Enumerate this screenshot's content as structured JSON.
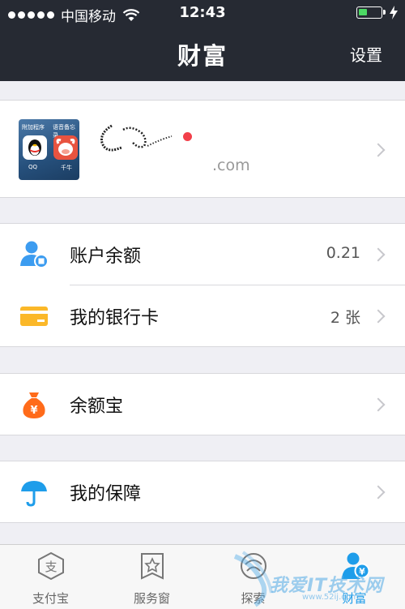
{
  "status": {
    "carrier": "中国移动",
    "time": "12:43",
    "battery_level": 0.4
  },
  "nav": {
    "title": "财富",
    "settings_label": "设置"
  },
  "profile": {
    "email_suffix": ".com",
    "avatar_labels": [
      "附加程序",
      "语音备忘录",
      "QQ",
      "千牛"
    ]
  },
  "rows": {
    "balance": {
      "label": "账户余额",
      "value": "0.21",
      "icon": "user-balance-icon"
    },
    "bank_card": {
      "label": "我的银行卡",
      "value": "2 张",
      "icon": "card-icon"
    },
    "yuebao": {
      "label": "余额宝",
      "icon": "money-bag-icon"
    },
    "insurance": {
      "label": "我的保障",
      "icon": "umbrella-icon"
    }
  },
  "tabs": [
    {
      "label": "支付宝",
      "icon": "alipay-icon"
    },
    {
      "label": "服务窗",
      "icon": "star-window-icon"
    },
    {
      "label": "探索",
      "icon": "explore-icon"
    },
    {
      "label": "财富",
      "icon": "wealth-icon"
    }
  ],
  "watermark": {
    "text": "我爱IT技术网",
    "url": "www.52ij.com"
  },
  "colors": {
    "nav_bg": "#262a33",
    "page_bg": "#efeff4",
    "accent_blue": "#1e9dea",
    "card_yellow": "#fbb829",
    "bag_orange": "#ff6b1a",
    "red_dot": "#f2404a"
  }
}
